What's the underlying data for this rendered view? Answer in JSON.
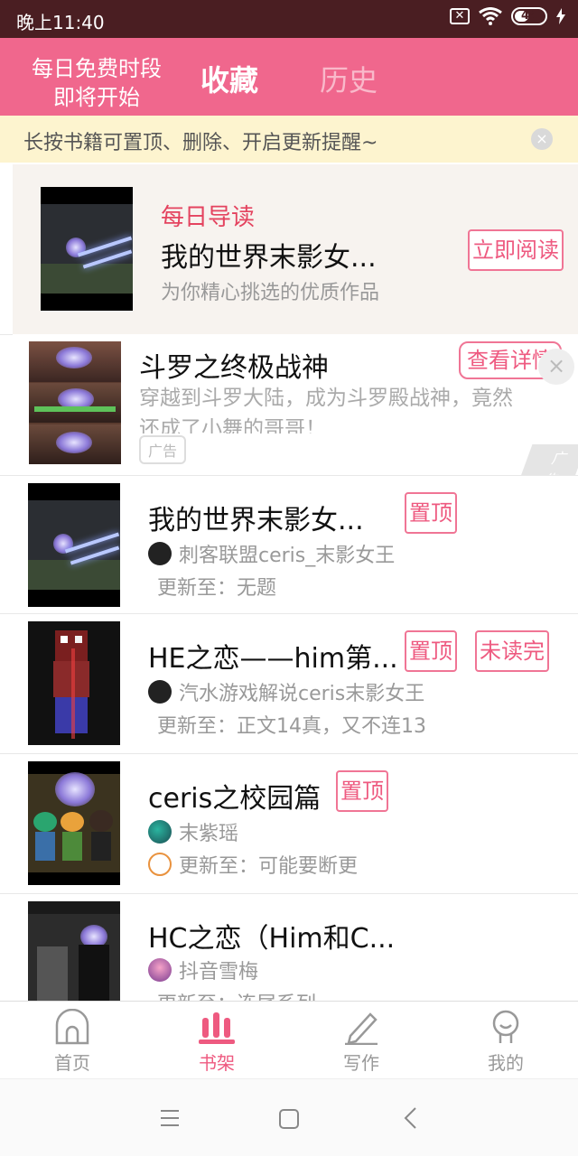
{
  "status_bar": {
    "time": "晚上11:40",
    "battery": "44"
  },
  "header": {
    "free_time_line1": "每日免费时段",
    "free_time_line2": "即将开始",
    "tab_favorites": "收藏",
    "tab_history": "历史"
  },
  "tip": {
    "text": "长按书籍可置顶、删除、开启更新提醒~",
    "close": "×"
  },
  "daily": {
    "label": "每日导读",
    "title": "我的世界末影女...",
    "subtitle": "为你精心挑选的优质作品",
    "read_button": "立即阅读"
  },
  "ad": {
    "title": "斗罗之终极战神",
    "desc_line1": "穿越到斗罗大陆，成为斗罗殿战神，竟然",
    "desc_line2": "还成了小舞的哥哥！",
    "detail_button": "查看详情",
    "tag": "广告",
    "mark": "广告",
    "close": "×"
  },
  "books": [
    {
      "title": "我的世界末影女...",
      "author": "刺客联盟ceris_末影女王",
      "update": "更新至：无题",
      "pin": "置顶"
    },
    {
      "title": "HE之恋——him第...",
      "author": "汽水游戏解说ceris末影女王",
      "update": "更新至：正文14真，又不连13",
      "pin": "置顶",
      "unread": "未读完"
    },
    {
      "title": "ceris之校园篇",
      "author": "末紫瑶",
      "update": "更新至：可能要断更",
      "pin": "置顶"
    },
    {
      "title": "HC之恋（Him和C...",
      "author": "抖音雪梅",
      "update": "更新至：连尾系列"
    }
  ],
  "bottom_nav": [
    {
      "label": "首页",
      "icon": "home-icon"
    },
    {
      "label": "书架",
      "icon": "bookshelf-icon"
    },
    {
      "label": "写作",
      "icon": "pen-icon"
    },
    {
      "label": "我的",
      "icon": "profile-icon"
    }
  ],
  "colors": {
    "accent": "#f0678d",
    "status_bar": "#4a1e22",
    "tip_bg": "#fdf4cf"
  }
}
